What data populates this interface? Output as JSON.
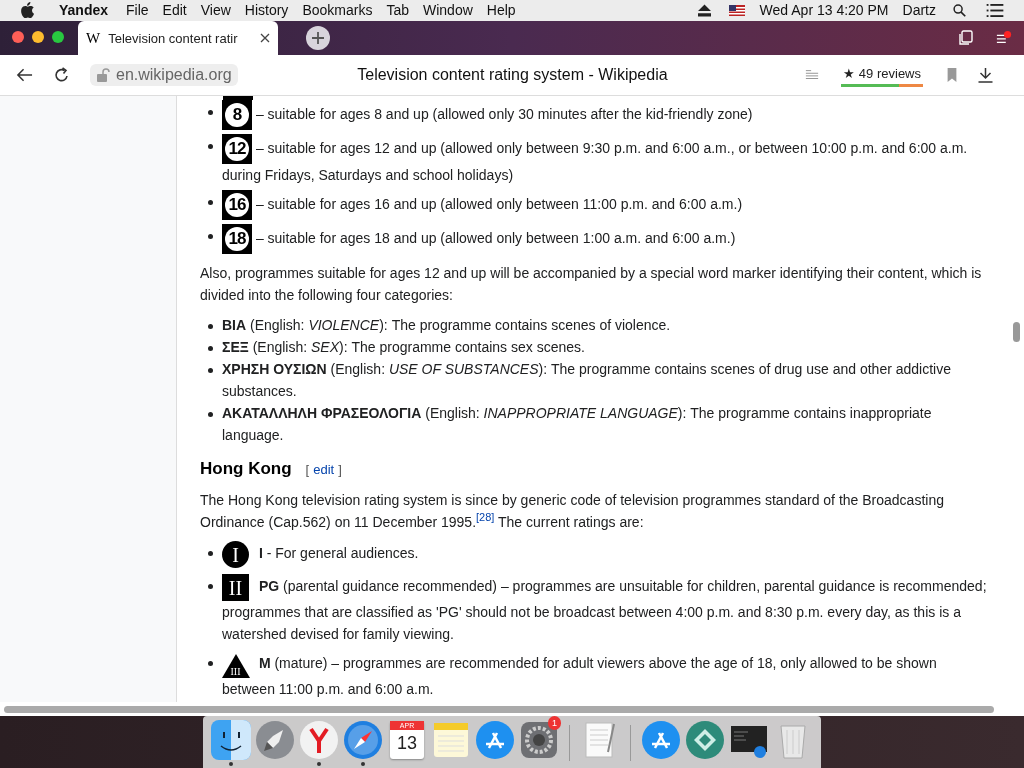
{
  "menubar": {
    "app": "Yandex",
    "items": [
      "File",
      "Edit",
      "View",
      "History",
      "Bookmarks",
      "Tab",
      "Window",
      "Help"
    ],
    "clock": "Wed Apr 13  4:20 PM",
    "user": "Dartz"
  },
  "tabs": [
    {
      "favicon": "W",
      "title": "Television content ratir",
      "selected": true
    }
  ],
  "address_bar": {
    "domain": "en.wikipedia.org",
    "page_title": "Television content rating system - Wikipedia",
    "reviews": "★ 49 reviews"
  },
  "article": {
    "ratings": [
      {
        "badge": "8",
        "text": "– suitable for ages 8 and up (allowed only 30 minutes after the kid-friendly zone)"
      },
      {
        "badge": "12",
        "text": "– suitable for ages 12 and up (allowed only between 9:30 p.m. and 6:00 a.m., or between 10:00 p.m. and 6:00 a.m. during Fridays, Saturdays and school holidays)"
      },
      {
        "badge": "16",
        "text": "– suitable for ages 16 and up (allowed only between 11:00 p.m. and 6:00 a.m.)"
      },
      {
        "badge": "18",
        "text": "– suitable for ages 18 and up (allowed only between 1:00 a.m. and 6:00 a.m.)"
      }
    ],
    "paragraph": "Also, programmes suitable for ages 12 and up will be accompanied by a special word marker identifying their content, which is divided into the following four categories:",
    "markers": [
      "**ΒΙΑ** (English: *VIOLENCE*): The programme contains scenes of violence.",
      "**ΣΕΞ** (English: *SEX*): The programme contains sex scenes.",
      "**ΧΡΗΣΗ ΟΥΣΙΩΝ** (English: *USE OF SUBSTANCES*): The programme contains scenes of drug use and other addictive substances.",
      "**ΑΚΑΤΑΛΛΗΛΗ ΦΡΑΣΕΟΛΟΓΙΑ** (English: *INAPPROPRIATE LANGUAGE*): The programme contains inappropriate language."
    ],
    "section": {
      "heading": "Hong Kong",
      "edit_open": "[",
      "edit_link": "edit",
      "edit_close": "]",
      "intro_before": "The Hong Kong television rating system is since by generic code of television programmes standard of the Broadcasting Ordinance (Cap.562) on 11 December 1995.",
      "footnote": "[28]",
      "intro_after": " The current ratings are:",
      "ratings": [
        {
          "kind": "circle",
          "badge": "I",
          "text": "**I** - For general audiences."
        },
        {
          "kind": "square",
          "badge": "II",
          "text": "**PG** (parental guidance recommended) – programmes are unsuitable for children, parental guidance is recommended; programmes that are classified as 'PG' should not be broadcast between 4:00 p.m. and 8:30 p.m. every day, as this is a watershed devised for family viewing."
        },
        {
          "kind": "triangle",
          "badge": "III",
          "text": "**M** (mature) – programmes are recommended for adult viewers above the age of 18, only allowed to be shown between 11:00 p.m. and 6:00 a.m."
        }
      ]
    }
  },
  "dock": [
    {
      "kind": "finder",
      "running": true
    },
    {
      "kind": "launchpad",
      "running": false
    },
    {
      "kind": "yandex",
      "running": true
    },
    {
      "kind": "safari",
      "running": true
    },
    {
      "kind": "calendar",
      "month": "APR",
      "day": "13",
      "running": false
    },
    {
      "kind": "notes",
      "running": false
    },
    {
      "kind": "appstore",
      "running": false
    },
    {
      "kind": "settings",
      "badge": "1",
      "running": false
    },
    {
      "kind": "separator"
    },
    {
      "kind": "textedit",
      "running": false
    },
    {
      "kind": "separator"
    },
    {
      "kind": "appstore",
      "running": false
    },
    {
      "kind": "green",
      "running": false
    },
    {
      "kind": "screenshot",
      "running": false
    },
    {
      "kind": "trash",
      "running": false
    }
  ]
}
